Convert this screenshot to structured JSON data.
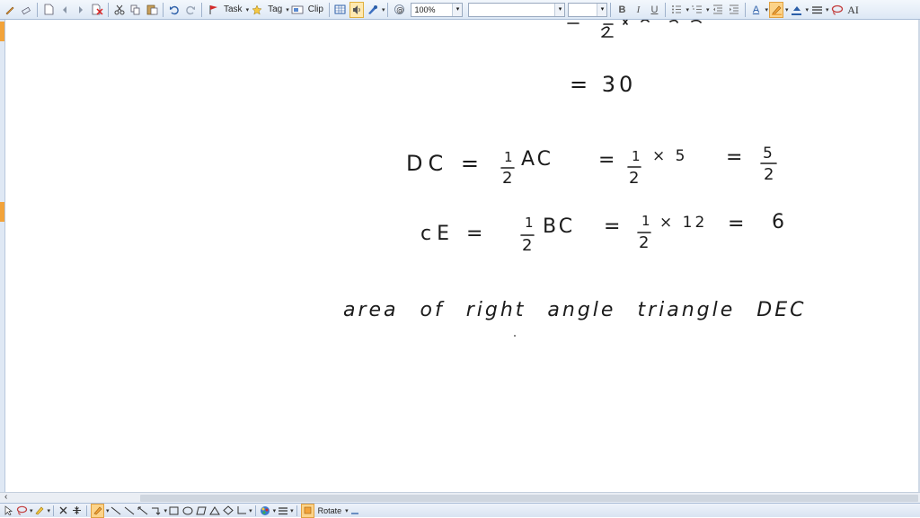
{
  "toolbar": {
    "task_label": "Task",
    "tag_label": "Tag",
    "clip_label": "Clip",
    "zoom_value": "100%",
    "font_name_value": "",
    "font_size_value": "",
    "bold_label": "B",
    "italic_label": "I",
    "underline_label": "U",
    "font_color_label": "A",
    "text_size_label": "AI"
  },
  "bottombar": {
    "rotate_label": "Rotate"
  },
  "ink": {
    "line_30": "= 30",
    "dc_lhs": "DC =",
    "dc_rhs1": "AC",
    "dc_eq2": "=",
    "dc_times": "× 5",
    "dc_eq3": "=",
    "dc_num": "5",
    "dc_den": "2",
    "ce_lhs": "cE =",
    "ce_rhs1": "BC",
    "ce_eq2": "=",
    "ce_times": "× 12",
    "ce_eq3": "=",
    "ce_result": "6",
    "half_num": "1",
    "half_den": "2",
    "area_text": "area of right angle triangle DEC"
  },
  "colors": {
    "accent_orange": "#f2a33a",
    "toolbar_bg": "#dde8f5"
  }
}
